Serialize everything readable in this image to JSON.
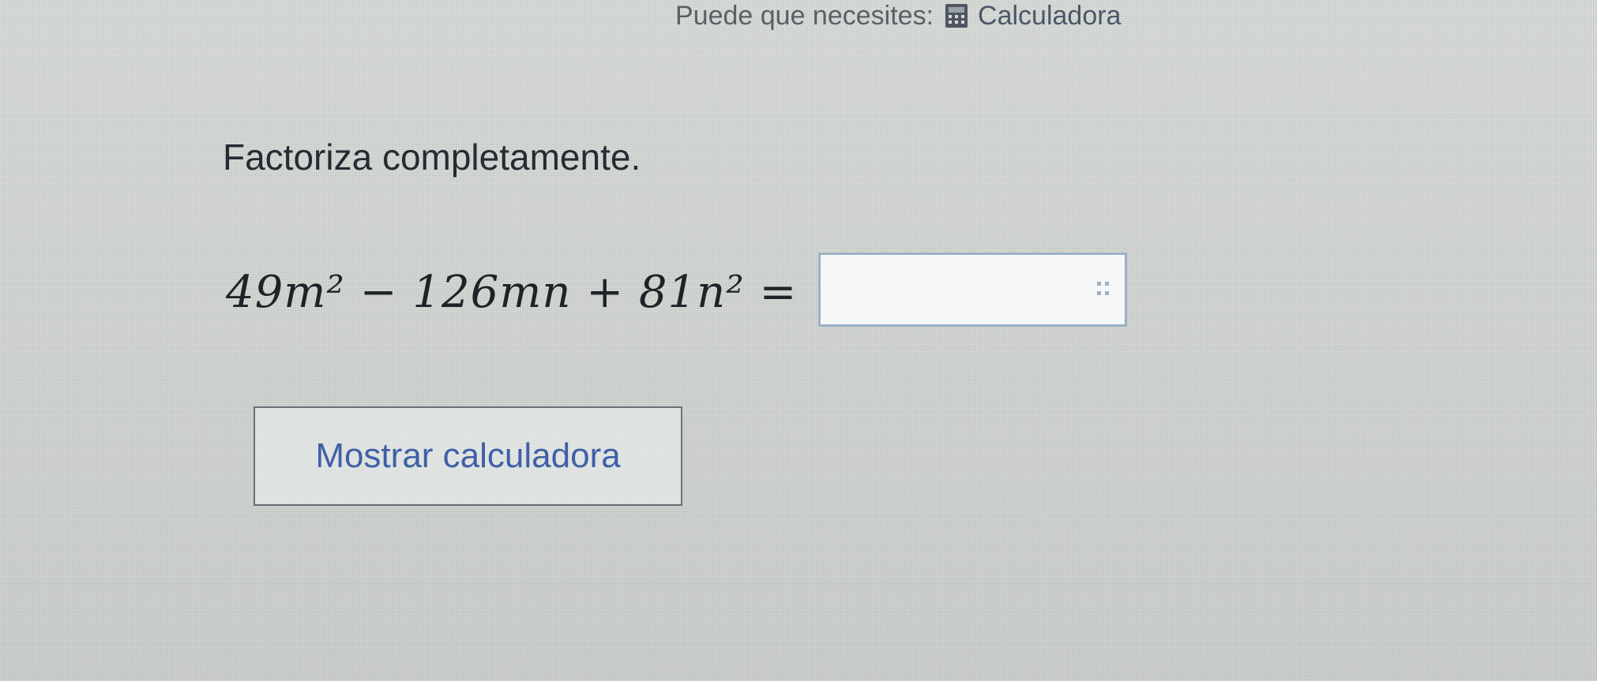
{
  "top_hint": {
    "prefix": "Puede que necesites:",
    "calculator_label": "Calculadora",
    "calculator_icon": "calculator-icon"
  },
  "problem": {
    "instruction": "Factoriza completamente.",
    "expression": "49m² − 126mn + 81n² ="
  },
  "answer": {
    "value": "",
    "placeholder": "",
    "grip_icon": "drag-grip-icon"
  },
  "actions": {
    "show_calculator_label": "Mostrar calculadora"
  },
  "colors": {
    "background": "#d6dad6",
    "link_blue": "#3f5fa7",
    "answer_border": "#9bb1c5"
  }
}
